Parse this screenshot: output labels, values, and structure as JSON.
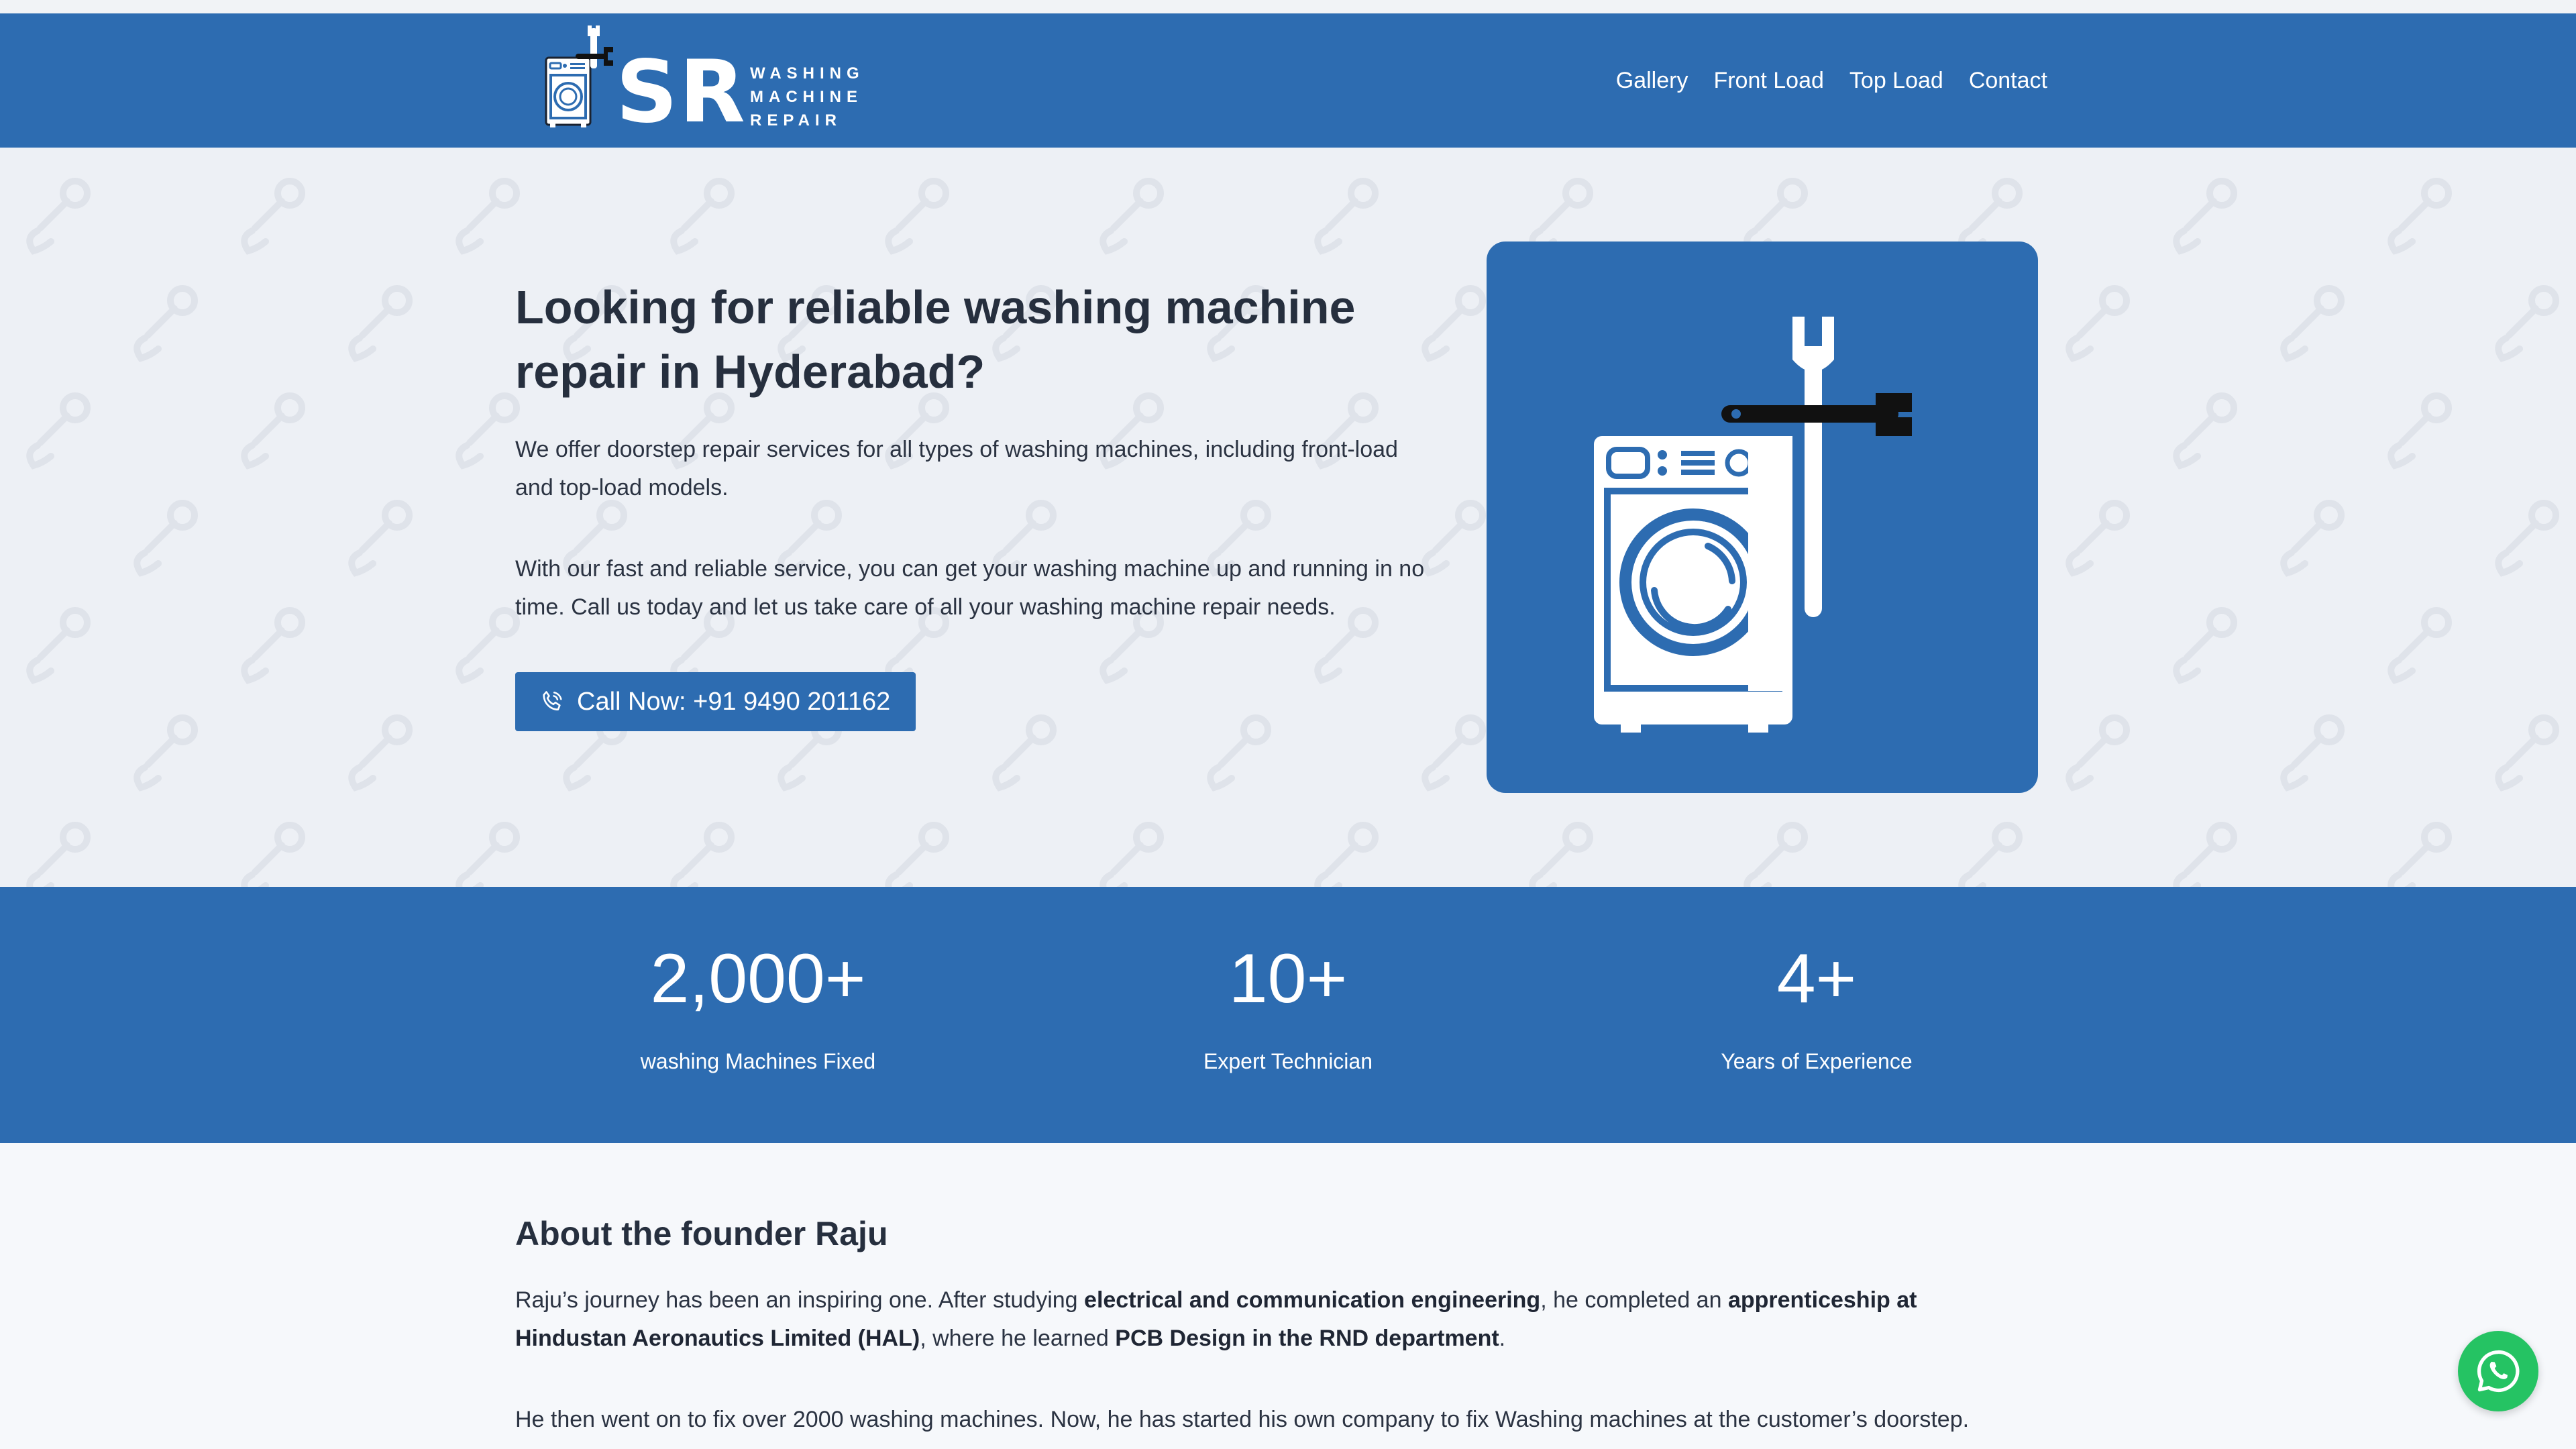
{
  "brand": {
    "initials": "SR",
    "tagline_lines": [
      "WASHING",
      "MACHINE",
      "REPAIR"
    ],
    "logo_icon": "washing-machine-wrench-icon"
  },
  "nav": {
    "items": [
      {
        "label": "Gallery"
      },
      {
        "label": "Front Load"
      },
      {
        "label": "Top Load"
      },
      {
        "label": "Contact"
      }
    ]
  },
  "hero": {
    "title": "Looking for reliable washing machine repair in Hyderabad?",
    "paragraph1": "We offer doorstep repair services for all types of washing machines, including front-load and top-load models.",
    "paragraph2": "With our fast and reliable service, you can get your washing machine up and running in no time. Call us today and let us take care of all your washing machine repair needs.",
    "call_button": "Call Now: +91 9490 201162",
    "call_icon": "phone-icon",
    "illustration_icon": "washing-machine-wrench-icon"
  },
  "stats": [
    {
      "value": "2,000+",
      "label": "washing Machines Fixed"
    },
    {
      "value": "10+",
      "label": "Expert Technician"
    },
    {
      "value": "4+",
      "label": "Years of Experience"
    }
  ],
  "about": {
    "title": "About the founder Raju",
    "p1_a": "Raju’s journey has been an inspiring one. After studying ",
    "p1_b": "electrical and communication engineering",
    "p1_c": ", he completed an ",
    "p1_d": "apprenticeship at Hindustan Aeronautics Limited (HAL)",
    "p1_e": ", where he learned ",
    "p1_f": "PCB Design in the RND department",
    "p1_g": ".",
    "p2": "He then went on to fix over 2000 washing machines. Now, he has started his own company to fix Washing machines at the customer’s doorstep."
  },
  "whatsapp": {
    "icon": "whatsapp-icon"
  },
  "colors": {
    "primary": "#2d6cb1",
    "hero_bg": "#edf0f5",
    "text": "#262f3e",
    "whatsapp": "#25c363"
  }
}
